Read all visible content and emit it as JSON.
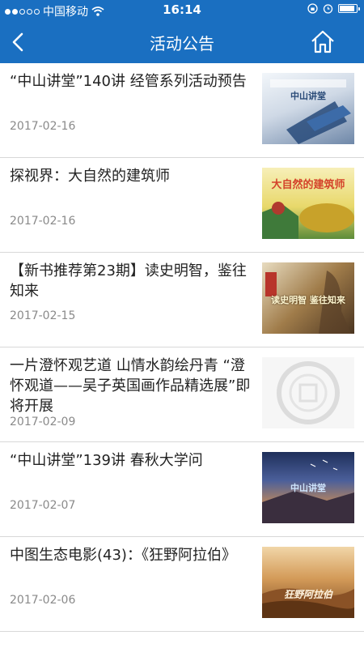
{
  "status": {
    "carrier": "中国移动",
    "time": "16:14"
  },
  "nav": {
    "title": "活动公告",
    "back_icon": "chevron-left-icon",
    "home_icon": "home-icon"
  },
  "items": [
    {
      "title": "“中山讲堂”140讲 经管系列活动预告",
      "date": "2017-02-16",
      "thumb_text": "中山讲堂"
    },
    {
      "title": "探视界：大自然的建筑师",
      "date": "2017-02-16",
      "thumb_text": "大自然的建筑师"
    },
    {
      "title": "【新书推荐第23期】读史明智，鉴往知来",
      "date": "2017-02-15",
      "thumb_text": "读史明智 鉴往知来"
    },
    {
      "title": "一片澄怀观艺道 山情水韵绘丹青 “澄怀观道——吴子英国画作品精选展”即将开展",
      "date": "2017-02-09",
      "thumb_text": ""
    },
    {
      "title": "“中山讲堂”139讲 春秋大学问",
      "date": "2017-02-07",
      "thumb_text": "中山讲堂"
    },
    {
      "title": "中图生态电影(43)：《狂野阿拉伯》",
      "date": "2017-02-06",
      "thumb_text": "狂野阿拉伯"
    }
  ]
}
